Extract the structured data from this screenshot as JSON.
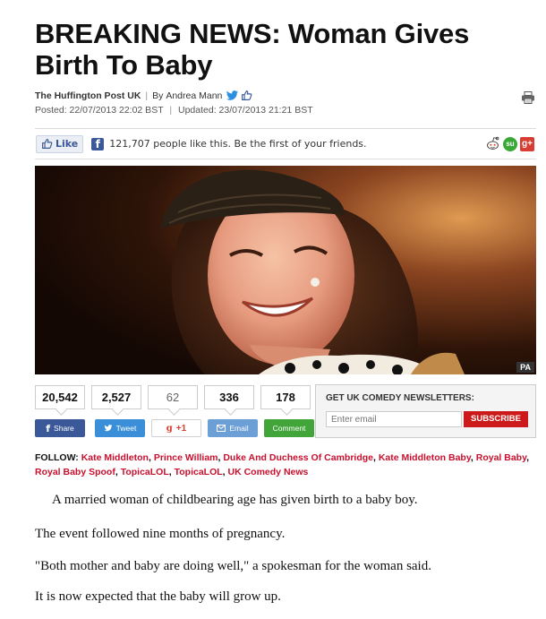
{
  "article": {
    "headline": "BREAKING NEWS: Woman Gives Birth To Baby",
    "source": "The Huffington Post UK",
    "author_prefix": "By",
    "author": "Andrea Mann",
    "posted": "Posted: 22/07/2013 22:02 BST",
    "updated": "Updated: 23/07/2013 21:21 BST"
  },
  "facebook": {
    "like_label": "Like",
    "text": "121,707 people like this. Be the first of your friends."
  },
  "photo": {
    "credit": "PA"
  },
  "counts": [
    "20,542",
    "2,527",
    "62",
    "336",
    "178"
  ],
  "share_buttons": {
    "facebook": "Share",
    "twitter": "Tweet",
    "google": "+1",
    "email": "Email",
    "comment": "Comment"
  },
  "newsletter": {
    "title": "GET UK COMEDY NEWSLETTERS:",
    "placeholder": "Enter email",
    "button": "SUBSCRIBE"
  },
  "follow": {
    "label": "FOLLOW:",
    "links": [
      "Kate Middleton",
      "Prince William",
      "Duke And Duchess Of Cambridge",
      "Kate Middleton Baby",
      "Royal Baby",
      "Royal Baby Spoof",
      "TopicaLOL",
      "TopicaLOL",
      "UK Comedy News"
    ]
  },
  "body": [
    "A married woman of childbearing age has given birth to a baby boy.",
    "The event followed nine months of pregnancy.",
    "\"Both mother and baby are doing well,\" a spokesman for the woman said.",
    "It is now expected that the baby will grow up."
  ],
  "colors": {
    "link": "#c8102e",
    "facebook": "#3b5998",
    "subscribe": "#cc1a1a"
  },
  "icons": [
    "twitter-bird-icon",
    "thumbs-up-icon",
    "printer-icon",
    "facebook-icon",
    "reddit-icon",
    "stumbleupon-icon",
    "google-plus-icon"
  ]
}
